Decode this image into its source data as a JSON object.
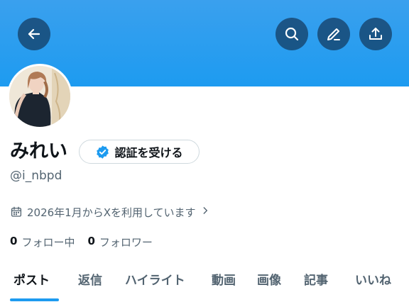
{
  "header": {
    "icons": [
      "arrow-left-icon",
      "search-icon",
      "edit-icon",
      "share-icon"
    ]
  },
  "profile": {
    "display_name": "みれい",
    "verify_button_label": "認証を受ける",
    "handle": "@i_nbpd",
    "joined_text": "2026年1月からXを利用しています",
    "following_count": "0",
    "following_label": "フォロー中",
    "followers_count": "0",
    "followers_label": "フォロワー"
  },
  "tabs": [
    {
      "label": "ポスト",
      "active": true
    },
    {
      "label": "返信",
      "active": false
    },
    {
      "label": "ハイライト",
      "active": false
    },
    {
      "label": "動画",
      "active": false
    },
    {
      "label": "画像",
      "active": false
    },
    {
      "label": "記事",
      "active": false
    },
    {
      "label": "いいね",
      "active": false
    }
  ],
  "colors": {
    "banner": "#1d9bf0",
    "accent": "#1d9bf0",
    "text_primary": "#0f1419",
    "text_secondary": "#536471"
  }
}
